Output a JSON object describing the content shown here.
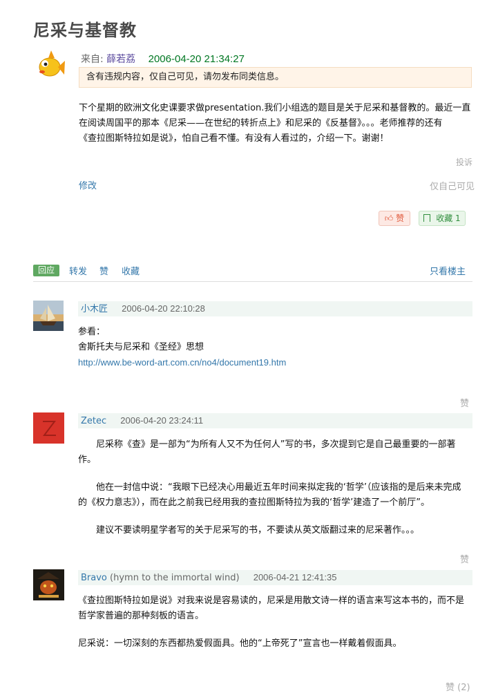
{
  "page": {
    "title": "尼采与基督教"
  },
  "post": {
    "from_label": "来自:",
    "author": "薛若荔",
    "time": "2006-04-20 21:34:27",
    "warning": "含有违规内容，仅自己可见，请勿发布同类信息。",
    "body": [
      "下个星期的欧洲文化史课要求做presentation.我们小组选的题目是关于尼采和基督教的。最近一直",
      "在阅读周国平的那本《尼采——在世纪的转折点上》和尼采的《反基督》。。。老师推荐的还有",
      "《查拉图斯特拉如是说》，怕自己看不懂。有没有人看过的，介绍一下。谢谢！"
    ],
    "report": "投诉",
    "edit": "修改",
    "visibility": "仅自己可见",
    "like_label": "赞",
    "fav_label": "收藏 1"
  },
  "tabs": {
    "reply": "回应",
    "forward": "转发",
    "like": "赞",
    "collect": "收藏",
    "op_only": "只看楼主"
  },
  "replies": [
    {
      "name": "小木匠",
      "time": "2006-04-20 22:10:28",
      "lines": [
        "参看：",
        "舍斯托夫与尼采和《圣经》思想"
      ],
      "link": "http://www.be-word-art.com.cn/no4/document19.htm",
      "like": "赞"
    },
    {
      "name": "Zetec",
      "time": "2006-04-20 23:24:11",
      "lines": [
        "尼采称《查》是一部为“为所有人又不为任何人”写的书，多次提到它是自己最重要的一部著",
        "作。",
        "他在一封信中说：“我眼下已经决心用最近五年时间来拟定我的‘哲学’（应该指的是后来未完成",
        "的《权力意志》），而在此之前我已经用我的查拉图斯特拉为我的‘哲学’建造了一个前厅”。",
        "建议不要读明星学者写的关于尼采写的书，不要读从英文版翻过来的尼采著作。。。"
      ],
      "like": "赞"
    },
    {
      "name": "Bravo",
      "name_suffix": "(hymn to the immortal wind)",
      "time": "2006-04-21 12:41:35",
      "lines": [
        "《查拉图斯特拉如是说》对我来说是容易读的，尼采是用散文诗一样的语言来写这本书的，而不是",
        "哲学家普遍的那种刻板的语言。",
        "尼采说：一切深刻的东西都热爱假面具。他的“上帝死了”宣言也一样戴着假面具。"
      ],
      "like": "赞 (2)"
    }
  ]
}
